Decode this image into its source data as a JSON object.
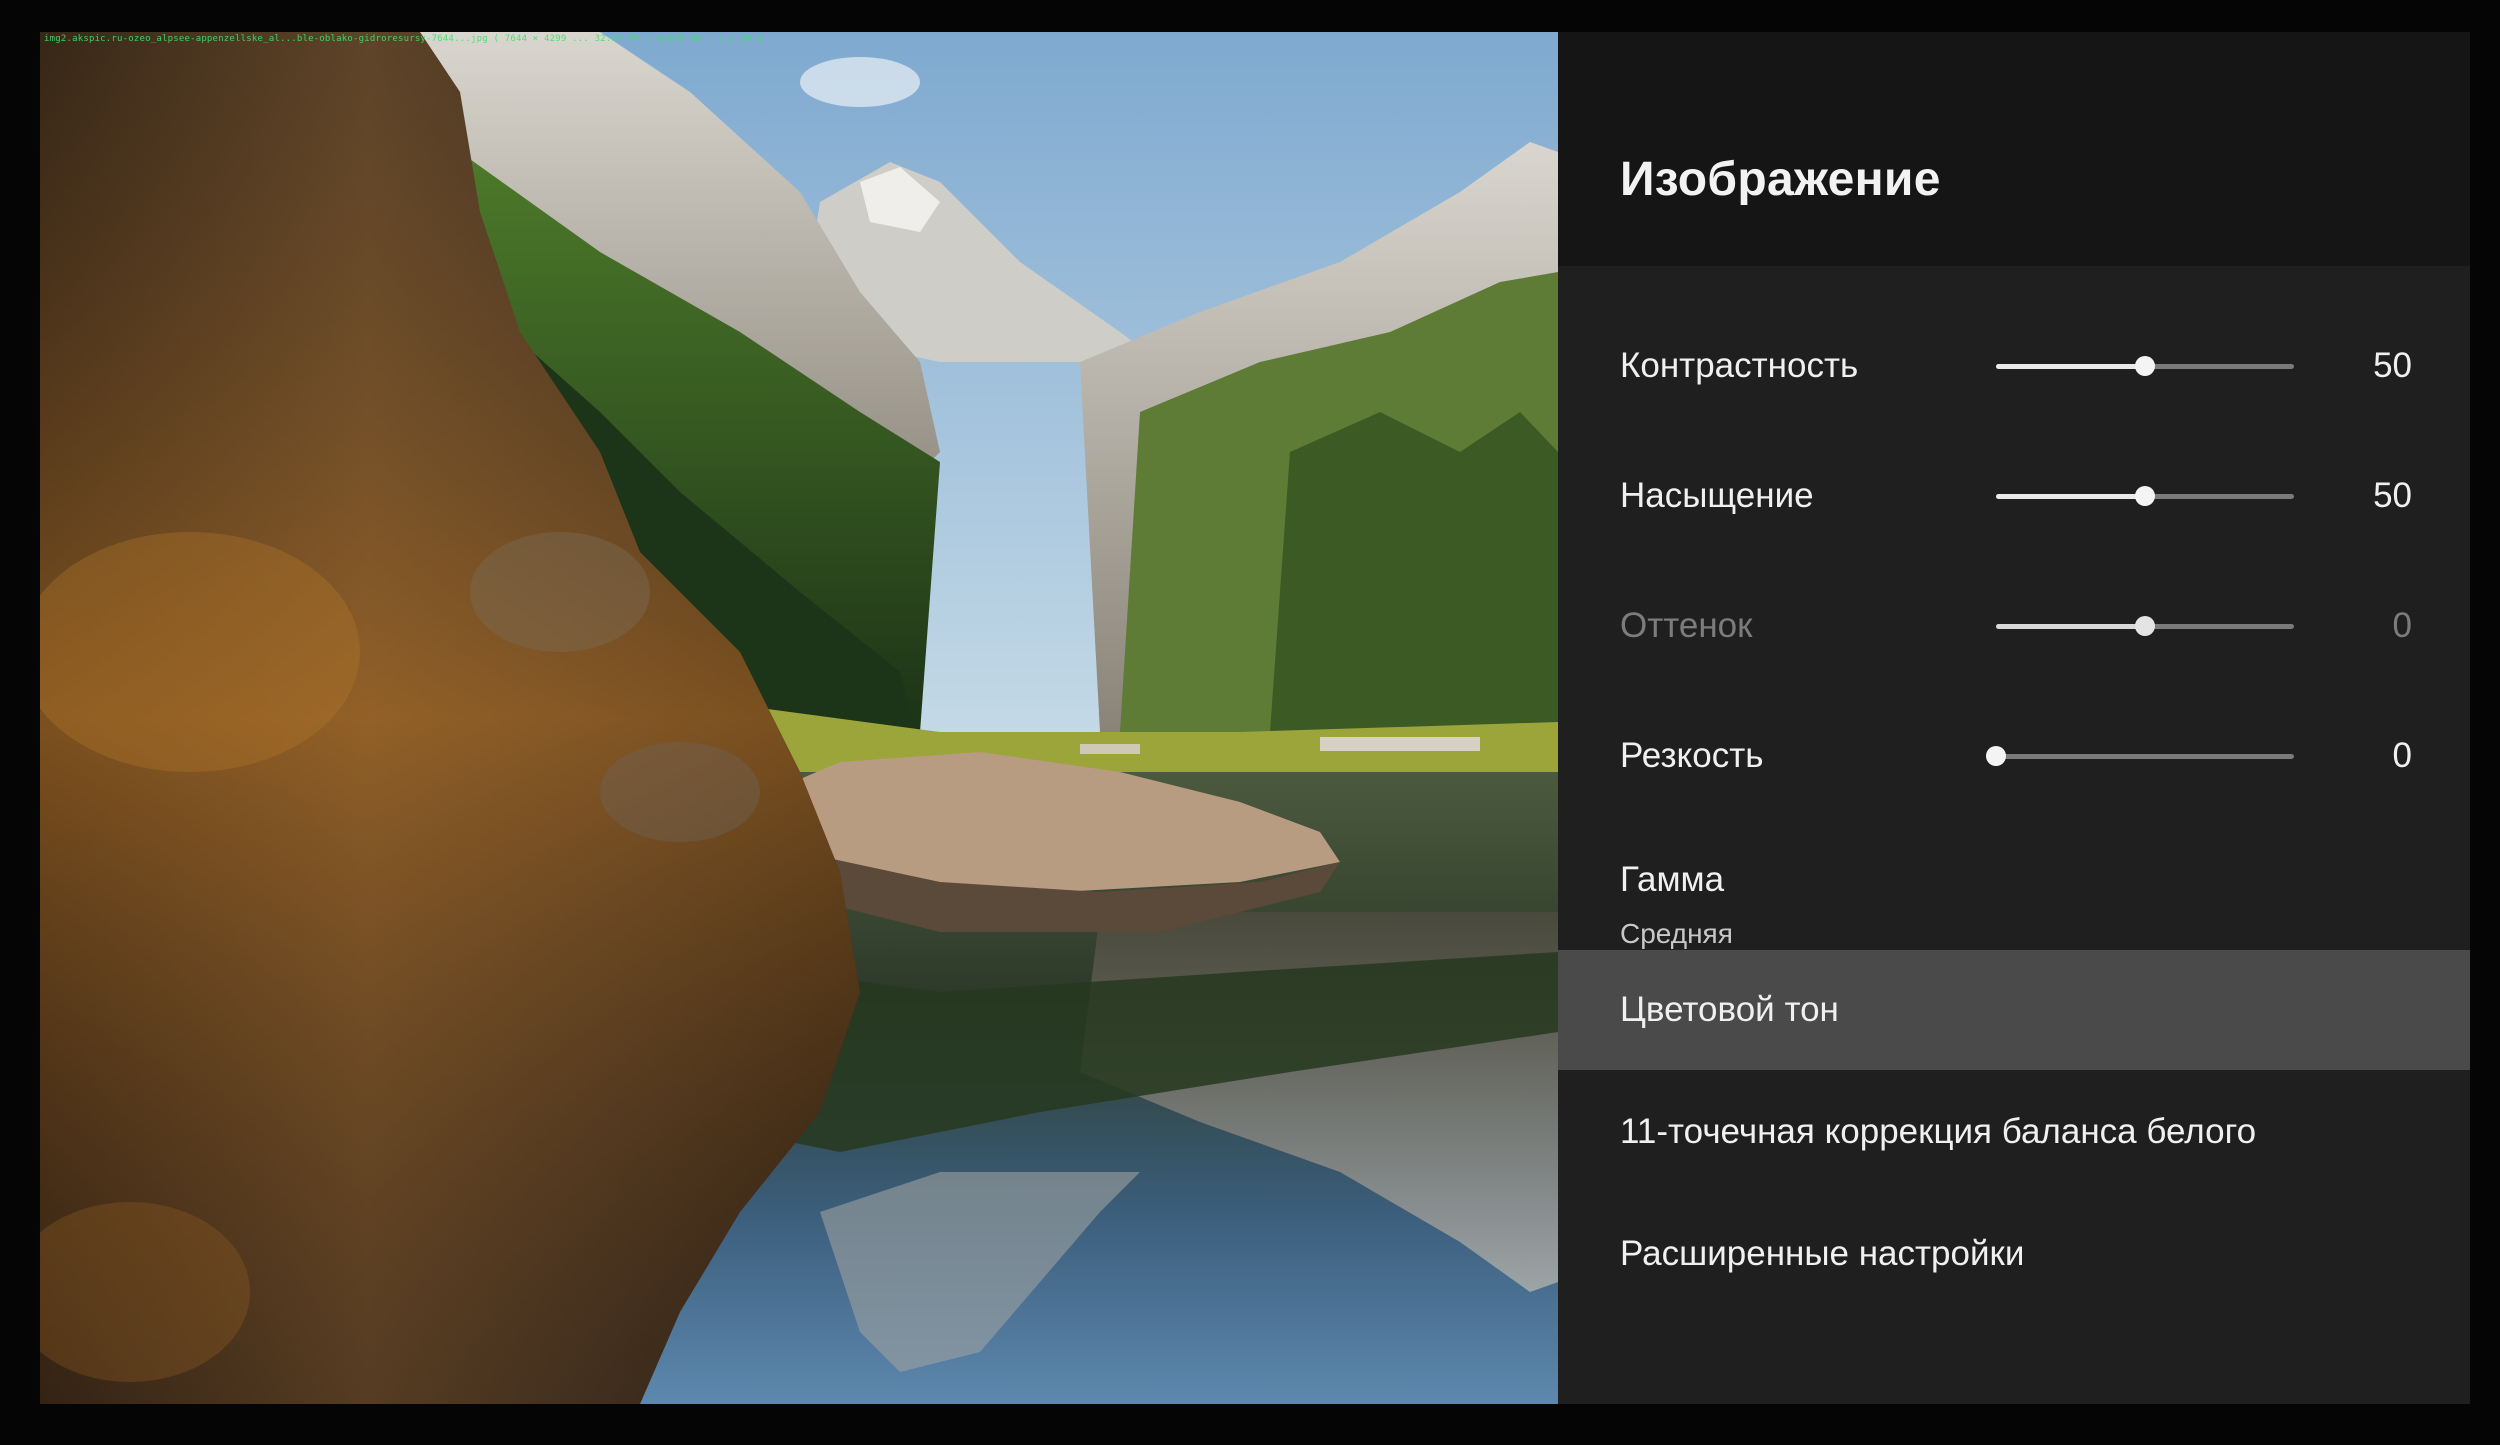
{
  "info_bar": "img2.akspic.ru-ozeo_alpsee-appenzellske_al...ble-oblako-gidroresursy-7644...jpg  ( 7644 × 4299 ...  32.87 MP )   6,070 KB  [ 1 / 29 ]",
  "panel": {
    "title": "Изображение"
  },
  "settings": {
    "contrast": {
      "label": "Контрастность",
      "value": "50",
      "level": 0.5,
      "enabled": true
    },
    "saturation": {
      "label": "Насыщение",
      "value": "50",
      "level": 0.5,
      "enabled": true
    },
    "hue": {
      "label": "Оттенок",
      "value": "0",
      "level": 0.5,
      "enabled": false
    },
    "sharpness": {
      "label": "Резкость",
      "value": "0",
      "level": 0.0,
      "enabled": true
    },
    "gamma": {
      "label": "Гамма",
      "value": "Средняя"
    },
    "color_tone": {
      "label": "Цветовой тон",
      "selected": true
    },
    "white_balance": {
      "label": "11-точечная коррекция баланса белого"
    },
    "advanced": {
      "label": "Расширенные настройки"
    }
  },
  "colors": {
    "panel_bg": "#1f1f1f",
    "header_bg": "#151515",
    "selected_bg": "#4a4a4a",
    "text": "#f0f0f0",
    "disabled_text": "#7c7c7c"
  }
}
